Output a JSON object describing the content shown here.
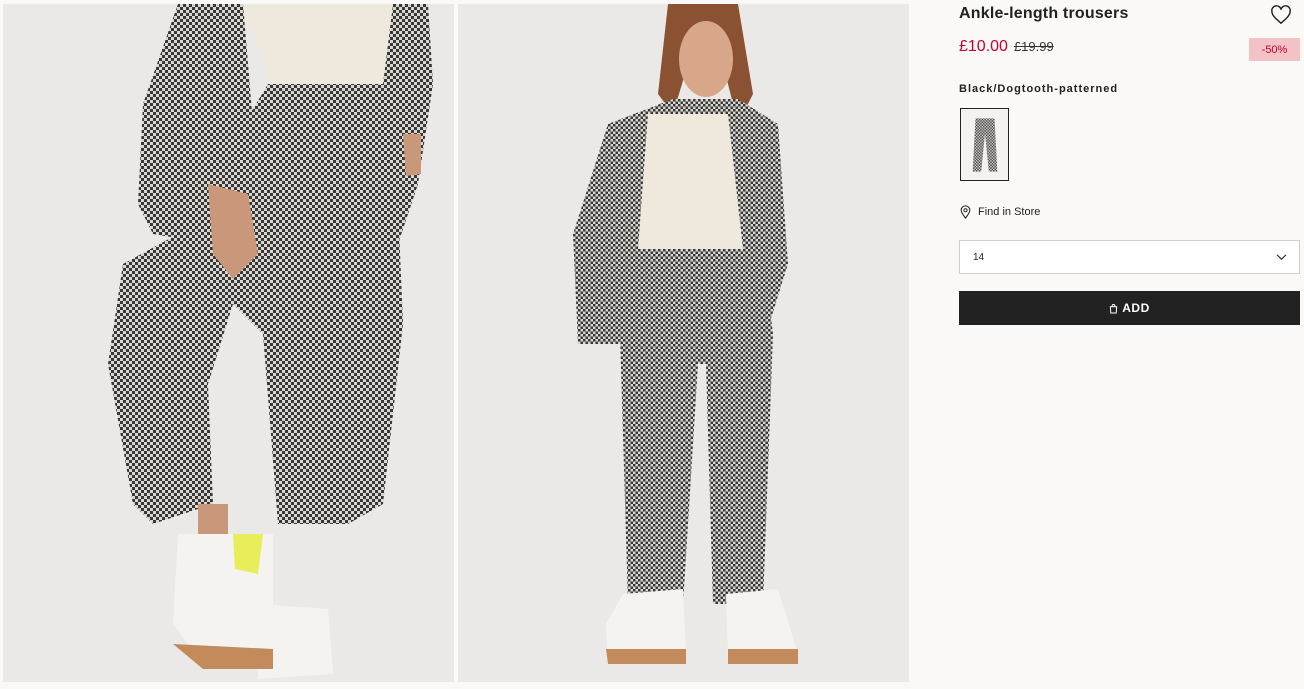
{
  "product": {
    "title": "Ankle-length trousers",
    "price_current": "£10.00",
    "price_original": "£19.99",
    "discount_badge": "-50%",
    "color_name": "Black/Dogtooth-patterned"
  },
  "actions": {
    "find_in_store": "Find in Store",
    "size_selected": "14",
    "add_label": "ADD"
  },
  "icons": {
    "favorite": "heart-icon",
    "store": "location-pin-icon",
    "dropdown": "chevron-down-icon",
    "bag": "shopping-bag-icon"
  },
  "colors": {
    "sale_red": "#c9002f",
    "badge_bg": "#f2c2c6",
    "button_bg": "#222222",
    "page_bg": "#faf9f8"
  }
}
